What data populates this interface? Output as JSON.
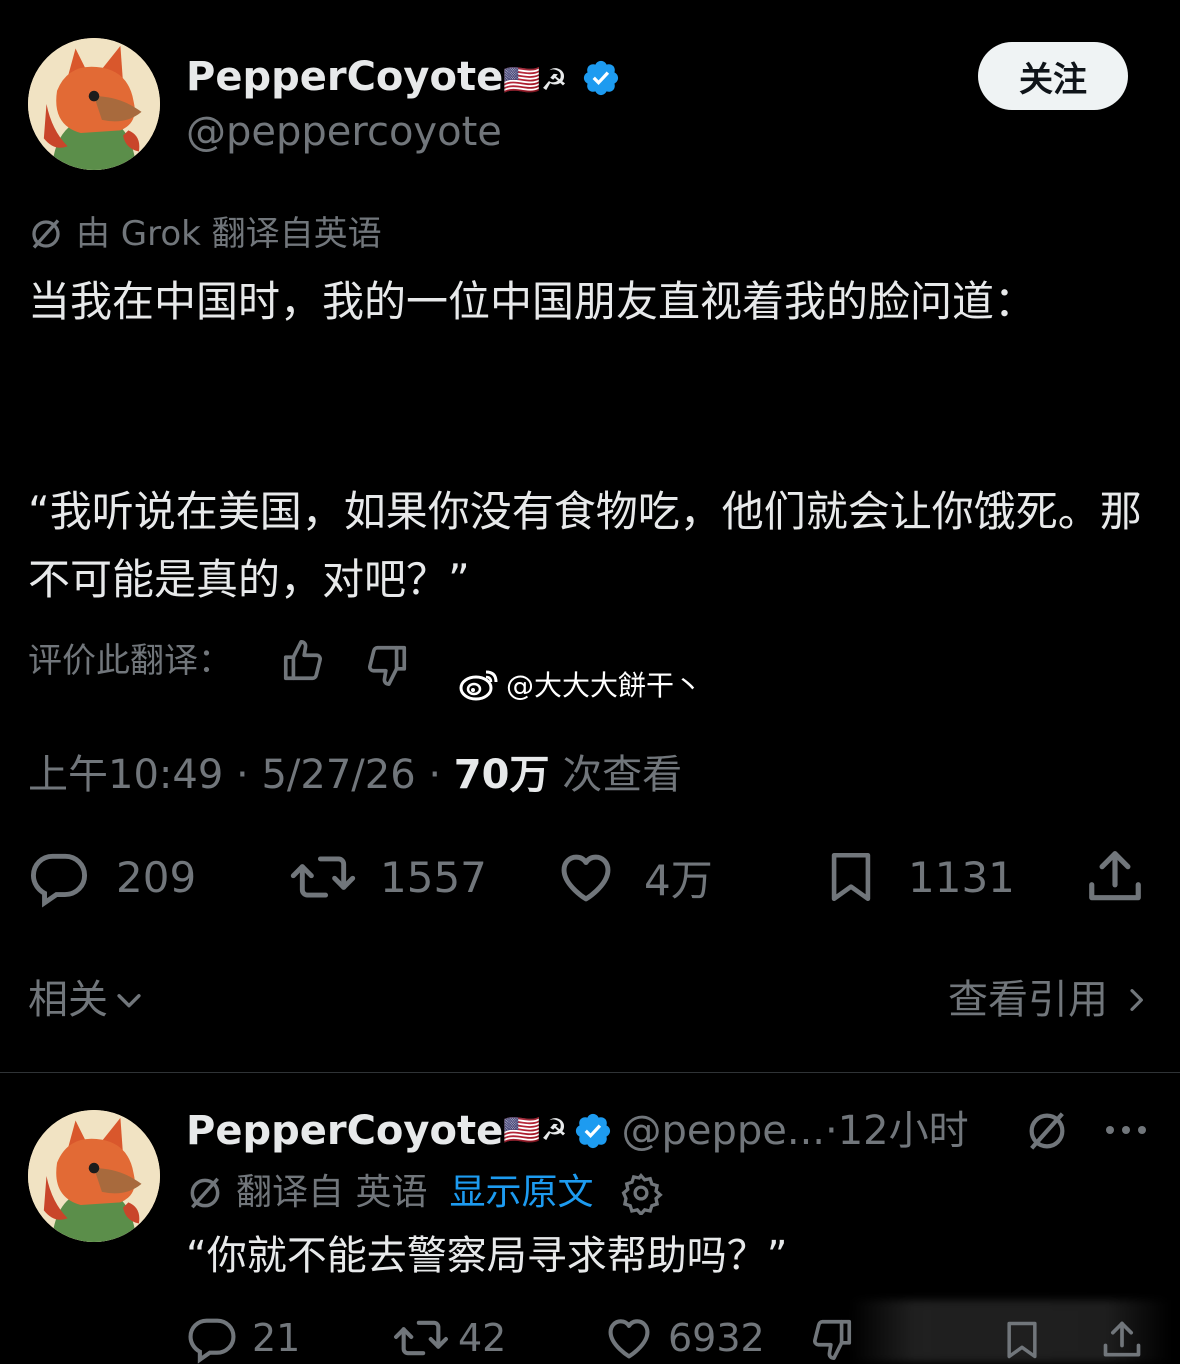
{
  "colors": {
    "background": "#000000",
    "text": "#e7e9ea",
    "muted": "#71767b",
    "link": "#1d9bf0",
    "verified": "#1d9bf0",
    "follow_bg": "#eff3f4"
  },
  "main_post": {
    "author": {
      "display_name": "PepperCoyote",
      "emoji": "🇺🇸☭",
      "handle": "@peppercoyote",
      "avatar_icon": "coyote-avatar",
      "verified_icon": "verified-badge-icon"
    },
    "follow_label": "关注",
    "translation_note": "由 Grok 翻译自英语",
    "text_paragraph_1": "当我在中国时，我的一位中国朋友直视着我的脸问道：",
    "text_paragraph_2": "“我听说在美国，如果你没有食物吃，他们就会让你饿死。那不可能是真的，对吧？”",
    "rate_translation_label": "评价此翻译：",
    "timestamp": "上午10:49",
    "date": "5/27/26",
    "views_count": "70万",
    "views_label": "次查看",
    "actions": {
      "replies": "209",
      "reposts": "1557",
      "likes": "4万",
      "bookmarks": "1131"
    },
    "related_label": "相关",
    "view_quotes_label": "查看引用"
  },
  "watermark": "@大大大餅干丶",
  "reply": {
    "author": {
      "display_name": "PepperCoyote",
      "emoji": "🇺🇸☭",
      "handle": "@peppe...",
      "time": "·12小时"
    },
    "translation_note": "翻译自 英语",
    "show_original_label": "显示原文",
    "text": "“你就不能去警察局寻求帮助吗？”",
    "actions": {
      "replies": "21",
      "reposts": "42",
      "likes": "6932"
    }
  }
}
